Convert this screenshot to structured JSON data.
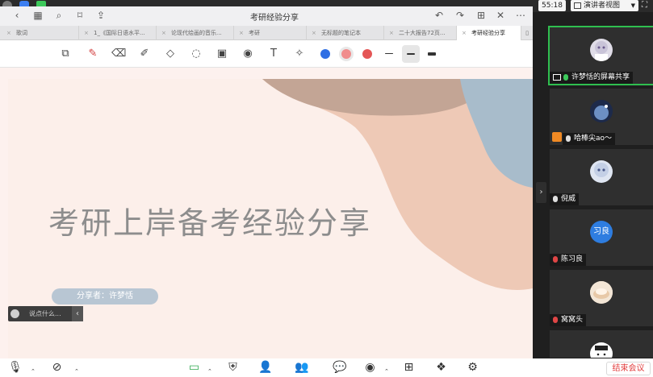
{
  "meeting": {
    "time": "55:18",
    "presenter_view_label": "演讲者视图",
    "end_meeting_label": "结束会议"
  },
  "document": {
    "title": "考研经验分享",
    "tabs": [
      {
        "label": "歌词",
        "active": false
      },
      {
        "label": "1_《国际日语水平...",
        "active": false
      },
      {
        "label": "论现代绘画的音乐...",
        "active": false
      },
      {
        "label": "考研",
        "active": false
      },
      {
        "label": "无标题的笔记本",
        "active": false
      },
      {
        "label": "二十大报告72页...",
        "active": false
      },
      {
        "label": "考研经验分享",
        "active": true
      }
    ],
    "colors": {
      "blue": "#2f6fe4",
      "pink": "#f08c8c",
      "red": "#e45656"
    }
  },
  "slide": {
    "title": "考研上岸备考经验分享",
    "presenter": "分享者：许梦恬"
  },
  "chat": {
    "placeholder": "说点什么..."
  },
  "participants": [
    {
      "name": "许梦恬的屏幕共享",
      "mic": "on",
      "sharing": true,
      "avatar": "anime-girl"
    },
    {
      "name": "哈棒尖ao～",
      "mic": "normal",
      "sharing": false,
      "avatar": "night-sky"
    },
    {
      "name": "倪威",
      "mic": "normal",
      "sharing": false,
      "avatar": "anime-girl-2"
    },
    {
      "name": "陈习良",
      "mic": "muted",
      "sharing": false,
      "avatar_text": "习良",
      "avatar_color": "#2e7de0"
    },
    {
      "name": "窝窝头",
      "mic": "muted",
      "sharing": false,
      "avatar": "food"
    },
    {
      "name": "",
      "mic": "normal",
      "sharing": false,
      "avatar": "cartoon-face"
    }
  ]
}
